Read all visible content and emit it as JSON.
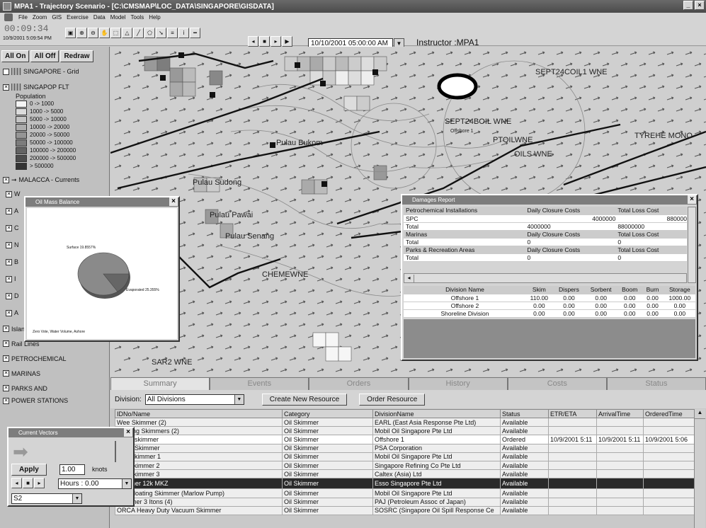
{
  "window": {
    "title": "MPA1 - Trajectory Scenario - [C:\\CMSMAP\\LOC_DATA\\SINGAPORE\\GISDATA]",
    "buttons": [
      "_",
      "×"
    ]
  },
  "menu": [
    "File",
    "Zoom",
    "GIS",
    "Exercise",
    "Data",
    "Model",
    "Tools",
    "Help"
  ],
  "toolbar": {
    "clock": "00:09:34",
    "clock_date": "10/9/2001 5:09:54 PM",
    "sim_datetime": "10/10/2001 05:00:00 AM",
    "instructor": "Instructor :MPA1",
    "dropdown_arrow": "▼"
  },
  "left": {
    "buttons": [
      "All On",
      "All Off",
      "Redraw"
    ],
    "layers": {
      "grid": "SINGAPORE - Grid",
      "flt": "SINGAPOP FLT",
      "pop": "Population",
      "currents": "MALACCA - Currents"
    },
    "legend": [
      {
        "label": "0 -> 1000",
        "color": "#f4f4f4"
      },
      {
        "label": "1000 -> 5000",
        "color": "#dcdcdc"
      },
      {
        "label": "5000 -> 10000",
        "color": "#c4c4c4"
      },
      {
        "label": "10000 -> 20000",
        "color": "#acacac"
      },
      {
        "label": "20000 -> 50000",
        "color": "#959595"
      },
      {
        "label": "50000 -> 100000",
        "color": "#7c7c7c"
      },
      {
        "label": "100000 -> 200000",
        "color": "#636363"
      },
      {
        "label": "200000 -> 500000",
        "color": "#4b4b4b"
      },
      {
        "label": "> 500000",
        "color": "#333333"
      }
    ],
    "hidden_letters": [
      "W",
      "A",
      "C",
      "N",
      "B",
      "I",
      "D",
      "A"
    ],
    "lower_layers": [
      "Island Names",
      "Rail Lines",
      "PETROCHEMICAL",
      "MARINAS",
      "PARKS AND",
      "POWER STATIONS"
    ]
  },
  "map_labels": [
    "SEPT24COIL1 WNE",
    "SEPT24BOIL WNE",
    "PTOILWNE",
    "OILS WNE",
    "TYREHE MONO",
    "Pulau Sudong",
    "Pulau Pawai",
    "Pulau Senang",
    "CHEMEWNE",
    "SAR2 WNE",
    "Pulau Bukom",
    "Offshore 1"
  ],
  "oil_mass": {
    "title": "Oil Mass Balance",
    "slice1": "Surface 19.8557%",
    "slice2": "Evaporated 25.355%",
    "footer": "Zero Vote, Water Volume, Ashore"
  },
  "damages": {
    "title": "Damages Report",
    "rows": [
      [
        "Petrochemical Installations",
        "Daily Closure Costs",
        "Total Loss Cost"
      ],
      [
        "SPC",
        "4000000",
        "880000"
      ],
      [
        "Total",
        "4000000",
        "88000000"
      ],
      [
        "Marinas",
        "Daily Closure Costs",
        "Total Loss Cost"
      ],
      [
        "Total",
        "0",
        "0"
      ],
      [
        "Parks & Recreation Areas",
        "Daily Closure Costs",
        "Total Loss Cost"
      ],
      [
        "Total",
        "0",
        "0"
      ]
    ],
    "div_header": [
      "Division Name",
      "Skim",
      "Dispers",
      "Sorbent",
      "Boom",
      "Burn",
      "Storage"
    ],
    "div_rows": [
      [
        "Offshore 1",
        "110.00",
        "0.00",
        "0.00",
        "0.00",
        "0.00",
        "1000.00"
      ],
      [
        "Offshore 2",
        "0.00",
        "0.00",
        "0.00",
        "0.00",
        "0.00",
        "0.00"
      ],
      [
        "Shoreline Division",
        "0.00",
        "0.00",
        "0.00",
        "0.00",
        "0.00",
        "0.00"
      ]
    ]
  },
  "tabs": [
    "Summary",
    "Events",
    "Orders",
    "History",
    "Costs",
    "Status"
  ],
  "division": {
    "label": "Division:",
    "value": "All Divisions",
    "create_button": "Create New Resource",
    "order_button": "Order Resource"
  },
  "grid": {
    "headers": [
      "IDNo/Name",
      "Category",
      "DivisionName",
      "Status",
      "ETR/ETA",
      "ArrivalTime",
      "OrderedTime"
    ],
    "rows": [
      [
        "Wee Skimmer (2)",
        "Oil Skimmer",
        "EARL (East Asia Response Pte Ltd)",
        "Available",
        "",
        "",
        ""
      ],
      [
        "Floating Skimmers (2)",
        "Oil Skimmer",
        "Mobil Oil Singapore Pte Ltd",
        "Available",
        "",
        "",
        ""
      ],
      [
        "EC14 skimmer",
        "Oil Skimmer",
        "Offshore 1",
        "Ordered",
        "10/9/2001 5:11",
        "10/9/2001 5:11",
        "10/9/2001 5:06"
      ],
      [
        "EC15 Skimmer",
        "Oil Skimmer",
        "PSA Corporation",
        "Available",
        "",
        "",
        ""
      ],
      [
        "Mini Skimmer 1",
        "Oil Skimmer",
        "Mobil Oil Singapore Pte Ltd",
        "Available",
        "",
        "",
        ""
      ],
      [
        "mini skimmer 2",
        "Oil Skimmer",
        "Singapore Refining Co Pte Ltd",
        "Available",
        "",
        "",
        ""
      ],
      [
        "mini skimmer 3",
        "Oil Skimmer",
        "Caltex (Asia) Ltd",
        "Available",
        "",
        "",
        ""
      ],
      [
        "skimmer 12k MKZ",
        "Oil Skimmer",
        "Esso Singapore Pte Ltd",
        "Available",
        "",
        "",
        ""
      ],
      [
        "Ray Floating Skimmer (Marlow Pump)",
        "Oil Skimmer",
        "Mobil Oil Singapore Pte Ltd",
        "Available",
        "",
        "",
        ""
      ],
      [
        "Skimmer 3 Itons (4)",
        "Oil Skimmer",
        "PAJ (Petroleum Assoc of Japan)",
        "Available",
        "",
        "",
        ""
      ],
      [
        "ORCA Heavy Duty Vacuum Skimmer",
        "Oil Skimmer",
        "SOSRC (Singapore Oil Spill Response Ce",
        "Available",
        "",
        "",
        ""
      ]
    ]
  },
  "current_window": {
    "title": "Current Vectors",
    "apply": "Apply",
    "speed": "1.00",
    "unit": "knots",
    "hours": "Hours : 0.00",
    "name": "S2"
  }
}
